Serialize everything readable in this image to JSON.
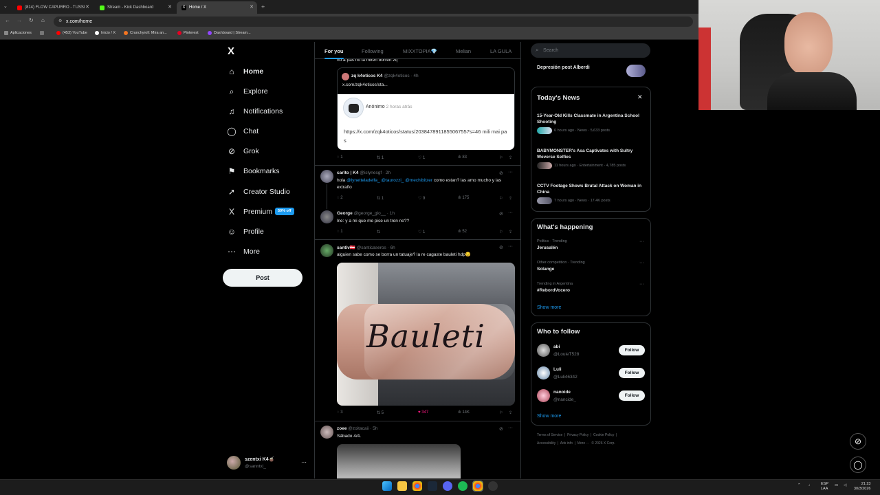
{
  "browser": {
    "tabs": [
      {
        "label": "(814) FLOW CAPURRO - TUSSI",
        "color": "#ff0000"
      },
      {
        "label": "Stream - Kick Dashboard",
        "color": "#53fc18"
      },
      {
        "label": "Home / X",
        "color": "#ffffff"
      }
    ],
    "url": "x.com/home",
    "bookmarks": [
      "Aplicaciones",
      "(453) YouTube",
      "Inicio / X",
      "Crunchyroll: Mira an...",
      "Pinterest",
      "Dashboard | Stream..."
    ]
  },
  "nav": {
    "logo": "X",
    "items": [
      {
        "label": "Home",
        "icon": "home-icon",
        "glyph": "⌂"
      },
      {
        "label": "Explore",
        "icon": "search-icon",
        "glyph": "⌕"
      },
      {
        "label": "Notifications",
        "icon": "bell-icon",
        "glyph": "♫"
      },
      {
        "label": "Chat",
        "icon": "chat-icon",
        "glyph": "◯"
      },
      {
        "label": "Grok",
        "icon": "grok-icon",
        "glyph": "⊘"
      },
      {
        "label": "Bookmarks",
        "icon": "bookmark-icon",
        "glyph": "⚑"
      },
      {
        "label": "Creator Studio",
        "icon": "rocket-icon",
        "glyph": "➚"
      },
      {
        "label": "Premium",
        "icon": "x-icon",
        "glyph": "X"
      },
      {
        "label": "Profile",
        "icon": "person-icon",
        "glyph": "☺"
      },
      {
        "label": "More",
        "icon": "more-icon",
        "glyph": "⋯"
      }
    ],
    "premium_badge": "50% off",
    "post": "Post",
    "account_name": "szentxi K4🧉",
    "account_handle": "@sanntxi_"
  },
  "feed": {
    "tabs": [
      "For you",
      "Following",
      "MIXXTOPIA💎",
      "Melian",
      "LA GULA"
    ],
    "top_text": "no a pas no la miren borren zq",
    "quote": {
      "name": "zq k4oticos K4",
      "handle": "@zqk4oticos · 4h",
      "text": "x.com/zqk4oticos/sta...",
      "inner_name": "Anónimo",
      "inner_time": "2 horas atrás",
      "inner_link": "https://x.com/zqk4oticos/status/2038478911855067557s=46 mili mai pas"
    },
    "quote_actions": [
      "1",
      "1",
      "1",
      "83"
    ],
    "post2": {
      "name": "carito | K4",
      "handle": "@islynesgf · 2h",
      "text_pre": "hola ",
      "mentions": "@lynetteladelfa_ @taurozzi_ @mechibitzer",
      "text_post": " como estan? las amo mucho y las extraño",
      "actions": [
        "2",
        "1",
        "9",
        "175"
      ]
    },
    "post3": {
      "name": "George",
      "handle": "@george_gio__ · 1h",
      "text": "lne: y a mi que me pise un tren no??",
      "actions": [
        "1",
        "",
        "1",
        "52"
      ]
    },
    "post4": {
      "name": "santiv🇦🇹",
      "handle": "@santicaseros · 6h",
      "text": "alguien sabe como se borra un tatuaje? la re cagaste bauleti hdp😔",
      "tattoo": "Bauleti",
      "actions": [
        "3",
        "5",
        "347",
        "14K"
      ]
    },
    "post5": {
      "name": "zoee",
      "handle": "@zoitacaii · 5h",
      "text": "Sábado 4/4."
    }
  },
  "right": {
    "search_placeholder": "Search",
    "top_trend": "Depresión post Alberdi",
    "news": {
      "title": "Today's News",
      "items": [
        {
          "headline": "15-Year-Old Kills Classmate in Argentina School Shooting",
          "meta": "6 hours ago · News · 5,633 posts"
        },
        {
          "headline": "BABYMONSTER's Asa Captivates with Sultry Weverse Selfies",
          "meta": "11 hours ago · Entertainment · 4,785 posts"
        },
        {
          "headline": "CCTV Footage Shows Brutal Attack on Woman in China",
          "meta": "7 hours ago · News · 17.4K posts"
        }
      ]
    },
    "happening": {
      "title": "What's happening",
      "items": [
        {
          "context": "Politics · Trending",
          "name": "Jerusalén"
        },
        {
          "context": "Other competition · Trending",
          "name": "Solange"
        },
        {
          "context": "Trending in Argentina",
          "name": "#RebordVocero"
        }
      ],
      "show_more": "Show more"
    },
    "who": {
      "title": "Who to follow",
      "items": [
        {
          "name": "abi",
          "handle": "@LouieT528"
        },
        {
          "name": "Luli",
          "handle": "@Luli46342"
        },
        {
          "name": "nanoide",
          "handle": "@nancide_"
        }
      ],
      "follow": "Follow",
      "show_more": "Show more"
    },
    "footer1": "Terms of Service  |  Privacy Policy  |  Cookie Policy  |",
    "footer2": "Accessibility  |  Ads info  |  More ···  © 2026 X Corp."
  },
  "taskbar": {
    "lang": "ESP",
    "lang2": "LAA",
    "time": "21:23",
    "date": "30/3/2026"
  },
  "colors": {
    "accent": "#1d9bf0",
    "like": "#f91880"
  }
}
